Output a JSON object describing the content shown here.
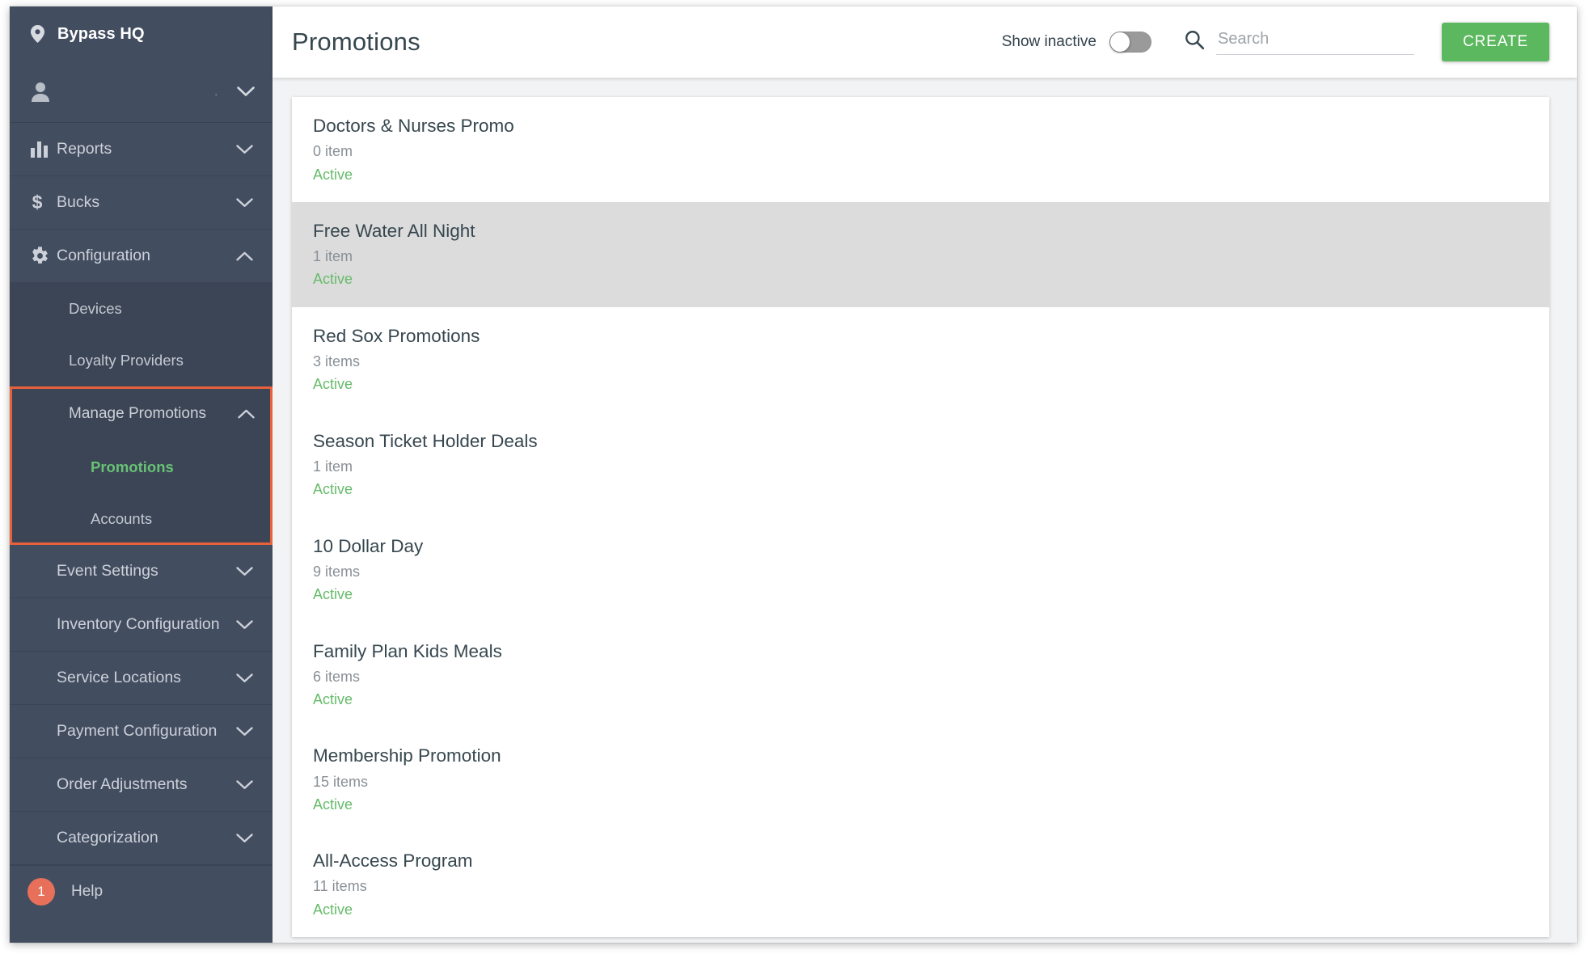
{
  "sidebar": {
    "org": {
      "name": "Bypass HQ",
      "icon": "location-pin-icon"
    },
    "user": {
      "label": ".",
      "icon": "person-icon",
      "chevron": "chevron-down-icon"
    },
    "nav": [
      {
        "label": "Reports",
        "icon": "bar-chart-icon",
        "chevron": "chevron-down-icon",
        "expanded": false
      },
      {
        "label": "Bucks",
        "icon": "dollar-icon",
        "chevron": "chevron-down-icon",
        "expanded": false
      },
      {
        "label": "Configuration",
        "icon": "gear-icon",
        "chevron": "chevron-up-icon",
        "expanded": true
      }
    ],
    "configuration_children": [
      {
        "label": "Devices"
      },
      {
        "label": "Loyalty Providers"
      }
    ],
    "manage_promotions": {
      "label": "Manage Promotions",
      "chevron": "chevron-up-icon",
      "children": [
        {
          "label": "Promotions",
          "active": true
        },
        {
          "label": "Accounts",
          "active": false
        }
      ]
    },
    "nav_bottom": [
      {
        "label": "Event Settings",
        "chevron": "chevron-down-icon"
      },
      {
        "label": "Inventory Configuration",
        "chevron": "chevron-down-icon"
      },
      {
        "label": "Service Locations",
        "chevron": "chevron-down-icon"
      },
      {
        "label": "Payment Configuration",
        "chevron": "chevron-down-icon"
      },
      {
        "label": "Order Adjustments",
        "chevron": "chevron-down-icon"
      },
      {
        "label": "Categorization",
        "chevron": "chevron-down-icon"
      }
    ],
    "help": {
      "label": "Help",
      "badge": "1"
    }
  },
  "topbar": {
    "title": "Promotions",
    "show_inactive_label": "Show inactive",
    "show_inactive_on": false,
    "search_placeholder": "Search",
    "search_value": "",
    "search_icon": "search-icon",
    "create_label": "CREATE"
  },
  "promotions": [
    {
      "name": "Doctors & Nurses Promo",
      "count": "0 item",
      "status": "Active",
      "highlighted": false
    },
    {
      "name": "Free Water All Night",
      "count": "1 item",
      "status": "Active",
      "highlighted": true
    },
    {
      "name": "Red Sox Promotions",
      "count": "3 items",
      "status": "Active",
      "highlighted": false
    },
    {
      "name": "Season Ticket Holder Deals",
      "count": "1 item",
      "status": "Active",
      "highlighted": false
    },
    {
      "name": "10 Dollar Day",
      "count": "9 items",
      "status": "Active",
      "highlighted": false
    },
    {
      "name": "Family Plan Kids Meals",
      "count": "6 items",
      "status": "Active",
      "highlighted": false
    },
    {
      "name": "Membership Promotion",
      "count": "15 items",
      "status": "Active",
      "highlighted": false
    },
    {
      "name": "All-Access Program",
      "count": "11 items",
      "status": "Active",
      "highlighted": false
    }
  ],
  "colors": {
    "sidebar_bg": "#434d60",
    "sidebar_sub_bg": "#3c4555",
    "accent_green": "#5cb85f",
    "status_green": "#66bb6a",
    "active_link_green": "#67c275",
    "annotation_orange": "#e8603c",
    "badge_red": "#e8705a",
    "row_highlight": "#dcdcdc",
    "page_bg": "#f2f3f5"
  }
}
